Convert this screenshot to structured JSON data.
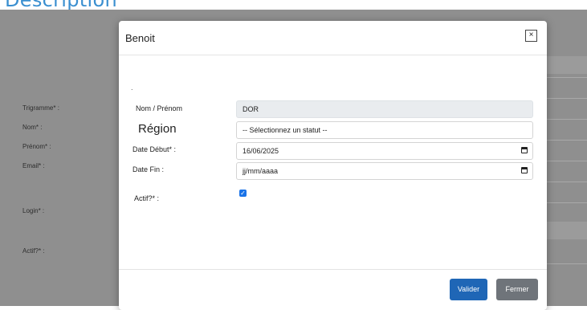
{
  "page": {
    "heading": "Description"
  },
  "background_form": {
    "labels": [
      "Trigramme* :",
      "Nom* :",
      "Prénom* :",
      "Email* :",
      "Login* :",
      "Actif?* :"
    ]
  },
  "modal": {
    "title": "Benoit",
    "close_symbol": "×",
    "dot": ".",
    "fields": {
      "nom_prenom": {
        "label": "Nom / Prénom",
        "value": "DOR"
      },
      "region": {
        "label": "Région",
        "value": "-- Sélectionnez un statut --"
      },
      "date_debut": {
        "label": "Date Début* :",
        "value": "16/06/2025",
        "icon": "calendar-icon"
      },
      "date_fin": {
        "label": "Date Fin :",
        "value": "jj/mm/aaaa",
        "icon": "calendar-icon"
      },
      "actif": {
        "label": "Actif?* :",
        "checked": true,
        "check_mark": "✓"
      }
    },
    "buttons": {
      "valider": "Valider",
      "fermer": "Fermer"
    }
  },
  "colors": {
    "primary": "#1f66b6",
    "secondary": "#6f747a",
    "backdrop": "#8f8f8f",
    "heading": "#3a8fd0"
  }
}
